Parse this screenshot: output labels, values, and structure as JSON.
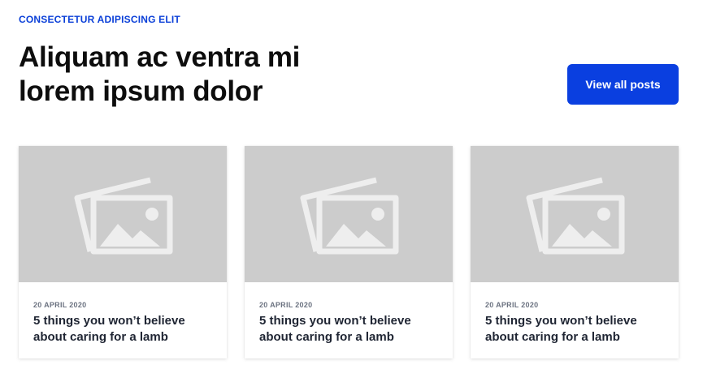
{
  "header": {
    "eyebrow": "CONSECTETUR ADIPISCING ELIT",
    "title": "Aliquam ac ventra mi lorem ipsum dolor",
    "view_all_label": "View all posts"
  },
  "colors": {
    "accent": "#0a3fe0",
    "eyebrow": "#0a3fd8",
    "placeholder_bg": "#cccccc"
  },
  "posts": [
    {
      "image_icon": "image-placeholder-icon",
      "date": "20 APRIL 2020",
      "title": "5 things you won’t believe about caring for a lamb"
    },
    {
      "image_icon": "image-placeholder-icon",
      "date": "20 APRIL 2020",
      "title": "5 things you won’t believe about caring for a lamb"
    },
    {
      "image_icon": "image-placeholder-icon",
      "date": "20 APRIL 2020",
      "title": "5 things you won’t believe about caring for a lamb"
    }
  ]
}
